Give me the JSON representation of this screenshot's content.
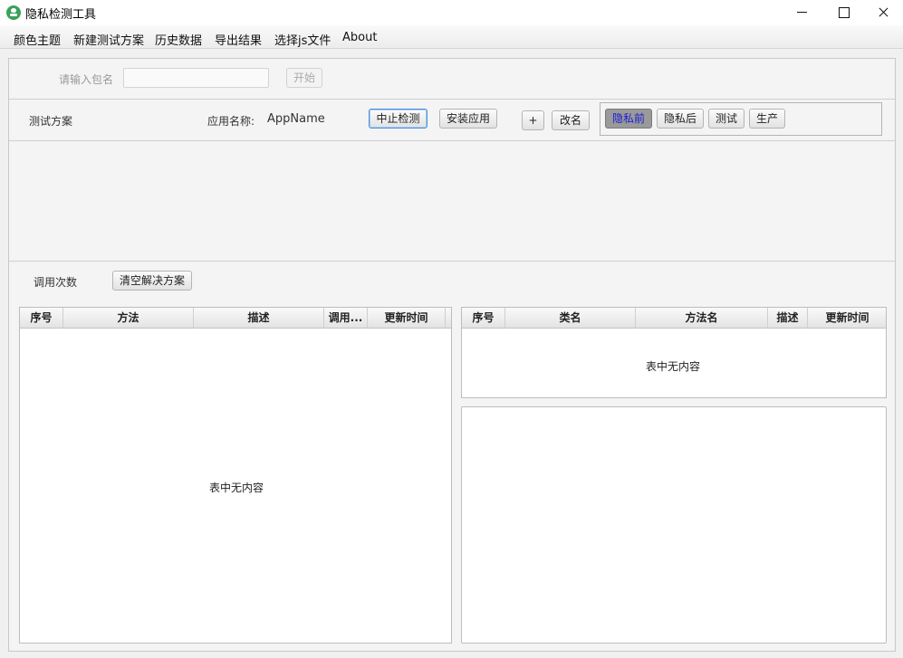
{
  "window": {
    "title": "隐私检测工具",
    "app_icon": "app-icon"
  },
  "menubar": {
    "items": [
      "颜色主题",
      "新建测试方案",
      "历史数据",
      "导出结果",
      "选择js文件",
      "About"
    ]
  },
  "package_row": {
    "label": "请输入包名",
    "input_value": "",
    "start_label": "开始"
  },
  "scheme_row": {
    "label": "测试方案",
    "app_name_label": "应用名称:",
    "app_name_value": "AppName",
    "stop_label": "中止检测",
    "install_label": "安装应用",
    "add_label": "+",
    "rename_label": "改名",
    "schemes": [
      "隐私前",
      "隐私后",
      "测试",
      "生产"
    ],
    "selected_scheme": "隐私前"
  },
  "calls_row": {
    "label": "调用次数",
    "clear_label": "清空解决方案"
  },
  "left_table": {
    "columns": [
      "序号",
      "方法",
      "描述",
      "调用...",
      "更新时间"
    ],
    "rows": [],
    "empty_text": "表中无内容"
  },
  "right_table": {
    "columns": [
      "序号",
      "类名",
      "方法名",
      "描述",
      "更新时间"
    ],
    "rows": [],
    "empty_text": "表中无内容"
  }
}
